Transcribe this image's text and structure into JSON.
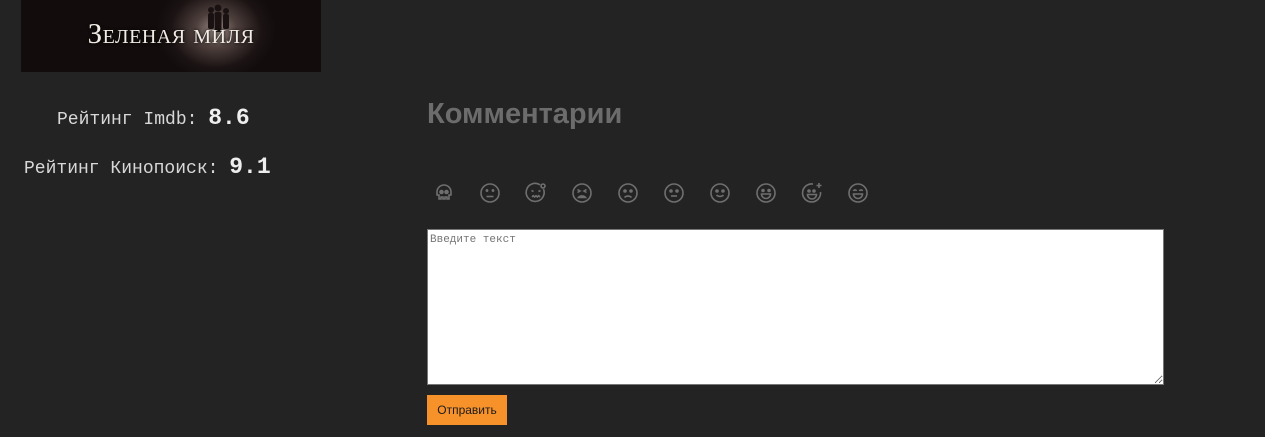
{
  "poster": {
    "title": "Зеленая миля"
  },
  "ratings": {
    "imdb_label": "Рейтинг Imdb:",
    "imdb_value": "8.6",
    "kinopoisk_label": "Рейтинг Кинопоиск:",
    "kinopoisk_value": "9.1"
  },
  "comments": {
    "title": "Комментарии",
    "emoji_names": [
      "skull-icon",
      "dizzy-face-icon",
      "confounded-face-icon",
      "tired-face-icon",
      "frowning-face-icon",
      "neutral-face-icon",
      "slightly-smiling-face-icon",
      "grinning-face-icon",
      "star-struck-face-icon",
      "beaming-face-icon"
    ],
    "placeholder": "Введите текст",
    "submit_label": "Отправить"
  },
  "colors": {
    "background": "#232323",
    "accent": "#f7922a",
    "title": "#6c6c6c",
    "icon": "#6f6f6f"
  }
}
